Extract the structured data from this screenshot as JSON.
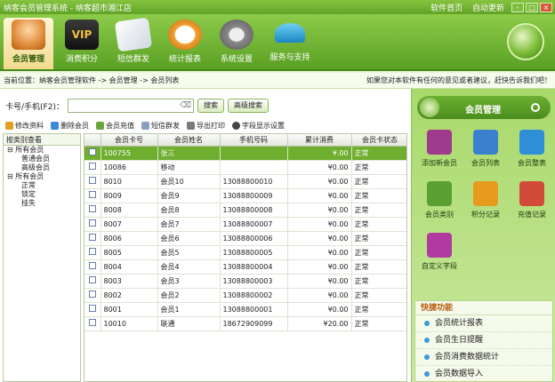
{
  "window": {
    "title": "纳客会员管理系统 - 纳客超市湘江店",
    "links": [
      "软件首页",
      "自动更新"
    ],
    "controls": [
      "-",
      "□",
      "×"
    ]
  },
  "toolbar": [
    {
      "label": "会员管理",
      "icon": "members-icon",
      "active": true
    },
    {
      "label": "消费积分",
      "icon": "vip-card-icon",
      "active": false
    },
    {
      "label": "短信群发",
      "icon": "sms-icon",
      "active": false
    },
    {
      "label": "统计报表",
      "icon": "clock-report-icon",
      "active": false
    },
    {
      "label": "系统设置",
      "icon": "gears-icon",
      "active": false
    },
    {
      "label": "服务与支持",
      "icon": "umbrella-icon",
      "active": false
    }
  ],
  "breadcrumb": {
    "text": "当前位置：纳客会员管理软件 -> 会员管理 -> 会员列表",
    "notice": "如果您对本软件有任何的意见或者建议，赶快告诉我们吧！"
  },
  "search": {
    "label": "卡号/手机(F2)：",
    "value": "",
    "clear": "⌫",
    "search_button": "搜索",
    "advanced_button": "高级搜索"
  },
  "actions": [
    "修改资料",
    "删除会员",
    "会员充值",
    "短信群发",
    "导出打印",
    "字段显示设置"
  ],
  "tree": {
    "header": "按类别查看",
    "nodes": [
      {
        "text": "⊟ 所有会员",
        "indent": 4
      },
      {
        "text": "普通会员",
        "indent": 20
      },
      {
        "text": "高级会员",
        "indent": 20
      },
      {
        "text": "⊟ 所有会员",
        "indent": 4
      },
      {
        "text": "正常",
        "indent": 20
      },
      {
        "text": "锁定",
        "indent": 20
      },
      {
        "text": "挂失",
        "indent": 20
      }
    ]
  },
  "table": {
    "columns": [
      "",
      "会员卡号",
      "会员姓名",
      "手机号码",
      "累计消费",
      "会员卡状态"
    ],
    "rows": [
      [
        "100755",
        "张三",
        "",
        "¥.00",
        "正常"
      ],
      [
        "10086",
        "移动",
        "",
        "¥0.00",
        "正常"
      ],
      [
        "8010",
        "会员10",
        "13088800010",
        "¥0.00",
        "正常"
      ],
      [
        "8009",
        "会员9",
        "13088800009",
        "¥0.00",
        "正常"
      ],
      [
        "8008",
        "会员8",
        "13088800008",
        "¥0.00",
        "正常"
      ],
      [
        "8007",
        "会员7",
        "13088800007",
        "¥0.00",
        "正常"
      ],
      [
        "8006",
        "会员6",
        "13088800006",
        "¥0.00",
        "正常"
      ],
      [
        "8005",
        "会员5",
        "13088800005",
        "¥0.00",
        "正常"
      ],
      [
        "8004",
        "会员4",
        "13088800004",
        "¥0.00",
        "正常"
      ],
      [
        "8003",
        "会员3",
        "13088800003",
        "¥0.00",
        "正常"
      ],
      [
        "8002",
        "会员2",
        "13088800002",
        "¥0.00",
        "正常"
      ],
      [
        "8001",
        "会员1",
        "13088800001",
        "¥0.00",
        "正常"
      ],
      [
        "10010",
        "联通",
        "18672909099",
        "¥20.00",
        "正常"
      ]
    ],
    "selected_row": 0
  },
  "panel": {
    "title": "会员管理",
    "items": [
      {
        "label": "添加新会员",
        "icon": "add-member-icon",
        "color": "#a03a8c"
      },
      {
        "label": "会员列表",
        "icon": "member-list-icon",
        "color": "#3b7fcf"
      },
      {
        "label": "会员整表",
        "icon": "dollar-icon",
        "color": "#2f8fd6"
      },
      {
        "label": "会员类别",
        "icon": "category-icon",
        "color": "#5aa030"
      },
      {
        "label": "积分记录",
        "icon": "points-icon",
        "color": "#e89a1e"
      },
      {
        "label": "充值记录",
        "icon": "recharge-icon",
        "color": "#d24a3a"
      },
      {
        "label": "自定义字段",
        "icon": "custom-field-icon",
        "color": "#b03aa0"
      }
    ],
    "quick_title": "快捷功能",
    "quick_items": [
      "会员统计报表",
      "会员生日提醒",
      "会员消费数据统计",
      "会员数据导入"
    ]
  }
}
